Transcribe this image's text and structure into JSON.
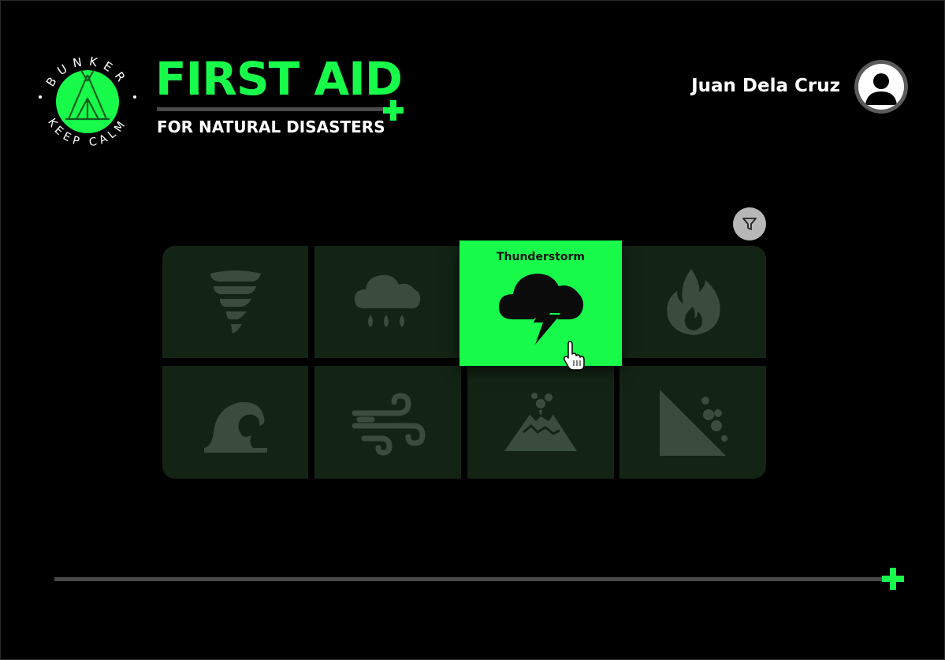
{
  "logo": {
    "top_text": "BUNKER",
    "bottom_text": "KEEP CALM",
    "icon": "tent-icon"
  },
  "header": {
    "title": "FIRST AID",
    "subtitle": "FOR NATURAL DISASTERS"
  },
  "user": {
    "name": "Juan Dela Cruz",
    "avatar_icon": "user-avatar-icon"
  },
  "filter": {
    "icon": "filter-icon"
  },
  "disasters": {
    "selected_label": "Thunderstorm",
    "items": [
      {
        "icon": "tornado-icon"
      },
      {
        "icon": "rain-cloud-icon"
      },
      {
        "icon": "thunderstorm-icon"
      },
      {
        "icon": "fire-icon"
      },
      {
        "icon": "tsunami-wave-icon"
      },
      {
        "icon": "wind-icon"
      },
      {
        "icon": "volcano-icon"
      },
      {
        "icon": "landslide-icon"
      }
    ]
  },
  "colors": {
    "accent": "#18fb4b",
    "background": "#000000",
    "tile": "#132415",
    "tile_icon": "#3a4d3c"
  }
}
